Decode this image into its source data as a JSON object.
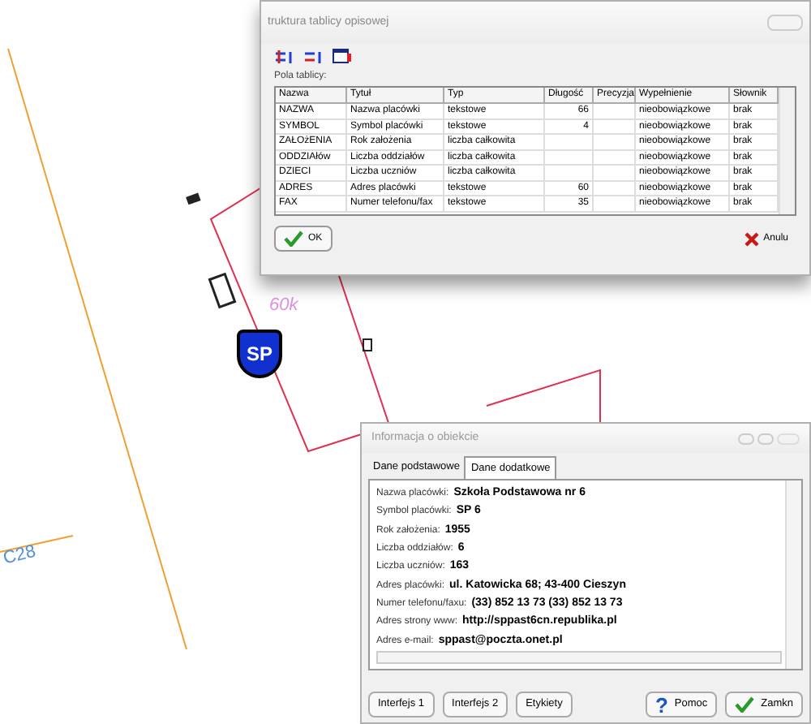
{
  "map": {
    "labels": [
      {
        "text": "60k",
        "kind": "area"
      },
      {
        "text": "C28",
        "kind": "street"
      }
    ],
    "marker": {
      "text": "SP"
    }
  },
  "structure_dialog": {
    "title": "truktura tablicy opisowej",
    "section_label": "Pola tablicy:",
    "columns": [
      "Nazwa",
      "Tytuł",
      "Typ",
      "Długość",
      "Precyzja",
      "Wypełnienie",
      "Słownik"
    ],
    "rows": [
      {
        "cells": [
          "NAZWA",
          "Nazwa placówki",
          "tekstowe",
          "66",
          "",
          "nieobowiązkowe",
          "brak"
        ]
      },
      {
        "cells": [
          "SYMBOL",
          "Symbol placówki",
          "tekstowe",
          "4",
          "",
          "nieobowiązkowe",
          "brak"
        ]
      },
      {
        "cells": [
          "ZAŁOżENIA",
          "Rok założenia",
          "liczba całkowita",
          "",
          "",
          "nieobowiązkowe",
          "brak"
        ]
      },
      {
        "cells": [
          "ODDZIAłów",
          "Liczba oddziałów",
          "liczba całkowita",
          "",
          "",
          "nieobowiązkowe",
          "brak"
        ]
      },
      {
        "cells": [
          "DZIECI",
          "Liczba uczniów",
          "liczba całkowita",
          "",
          "",
          "nieobowiązkowe",
          "brak"
        ]
      },
      {
        "cells": [
          "ADRES",
          "Adres placówki",
          "tekstowe",
          "60",
          "",
          "nieobowiązkowe",
          "brak"
        ]
      },
      {
        "cells": [
          "FAX",
          "Numer telefonu/fax",
          "tekstowe",
          "35",
          "",
          "nieobowiązkowe",
          "brak"
        ]
      }
    ],
    "buttons": [
      {
        "label": "OK",
        "kind": "ok"
      },
      {
        "label": "Anulu",
        "kind": "cancel"
      }
    ]
  },
  "info_dialog": {
    "title": "Informacja o obiekcie",
    "tabs": [
      {
        "label": "Dane podstawowe",
        "selected": false
      },
      {
        "label": "Dane dodatkowe",
        "selected": true
      }
    ],
    "fields": [
      {
        "label": "Nazwa placówki:",
        "value": "Szkoła Podstawowa nr 6"
      },
      {
        "label": "Symbol placówki:",
        "value": "SP 6"
      },
      {
        "label": "Rok założenia:",
        "value": "1955"
      },
      {
        "label": "Liczba oddziałów:",
        "value": "6"
      },
      {
        "label": "Liczba uczniów:",
        "value": "163"
      },
      {
        "label": "Adres placówki:",
        "value": "ul. Katowicka 68; 43-400 Cieszyn"
      },
      {
        "label": "Numer telefonu/faxu:",
        "value": "(33) 852 13 73   (33) 852 13 73"
      },
      {
        "label": "Adres strony www:",
        "value": "http://sppast6cn.republika.pl"
      },
      {
        "label": "Adres e-mail:",
        "value": "sppast@poczta.onet.pl"
      }
    ],
    "buttons": [
      {
        "label": "Interfejs 1",
        "kind": "plain"
      },
      {
        "label": "Interfejs 2",
        "kind": "plain"
      },
      {
        "label": "Etykiety",
        "kind": "plain"
      },
      {
        "label": "Pomoc",
        "kind": "help",
        "icon": "?"
      },
      {
        "label": "Zamkn",
        "kind": "ok"
      }
    ]
  }
}
